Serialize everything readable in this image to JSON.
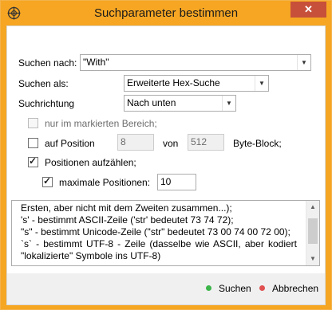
{
  "window": {
    "title": "Suchparameter bestimmen",
    "close_label": "✕",
    "accent": "#f6a623",
    "close_color": "#c7503a"
  },
  "form": {
    "search_label": "Suchen nach:",
    "search_value": "\"With\"",
    "search_as_label": "Suchen als:",
    "search_as_value": "Erweiterte Hex-Suche",
    "direction_label": "Suchrichtung",
    "direction_value": "Nach unten",
    "only_selection_label": "nur im markierten Bereich;",
    "at_position_label": "auf Position",
    "position_value": "8",
    "of_label": "von",
    "block_value": "512",
    "block_unit_label": "Byte-Block;",
    "list_positions_label": "Positionen aufzählen;",
    "max_positions_label": "maximale Positionen:",
    "max_positions_value": "10"
  },
  "checkboxes": {
    "only_selection": false,
    "at_position": false,
    "list_positions": true,
    "max_positions": true
  },
  "help_text": {
    "lines": [
      "Ersten, aber nicht mit dem Zweiten zusammen...);",
      "'s' - bestimmt ASCII-Zeile ('str' bedeutet 73 74 72);",
      "\"s\" - bestimmt Unicode-Zeile (\"str\" bedeutet 73 00 74 00 72 00);",
      "`s` - bestimmt UTF-8 - Zeile (dasselbe wie ASCII, aber kodiert",
      "\"lokalizierte\" Symbole ins UTF-8)"
    ]
  },
  "footer": {
    "search_button": "Suchen",
    "cancel_button": "Abbrechen",
    "search_dot_color": "#3cb54a",
    "cancel_dot_color": "#e05050"
  },
  "icons": {
    "app": "crosshair-globe-icon",
    "dropdown": "chevron-down-icon",
    "scroll_up": "arrow-up-icon",
    "scroll_down": "arrow-down-icon"
  }
}
